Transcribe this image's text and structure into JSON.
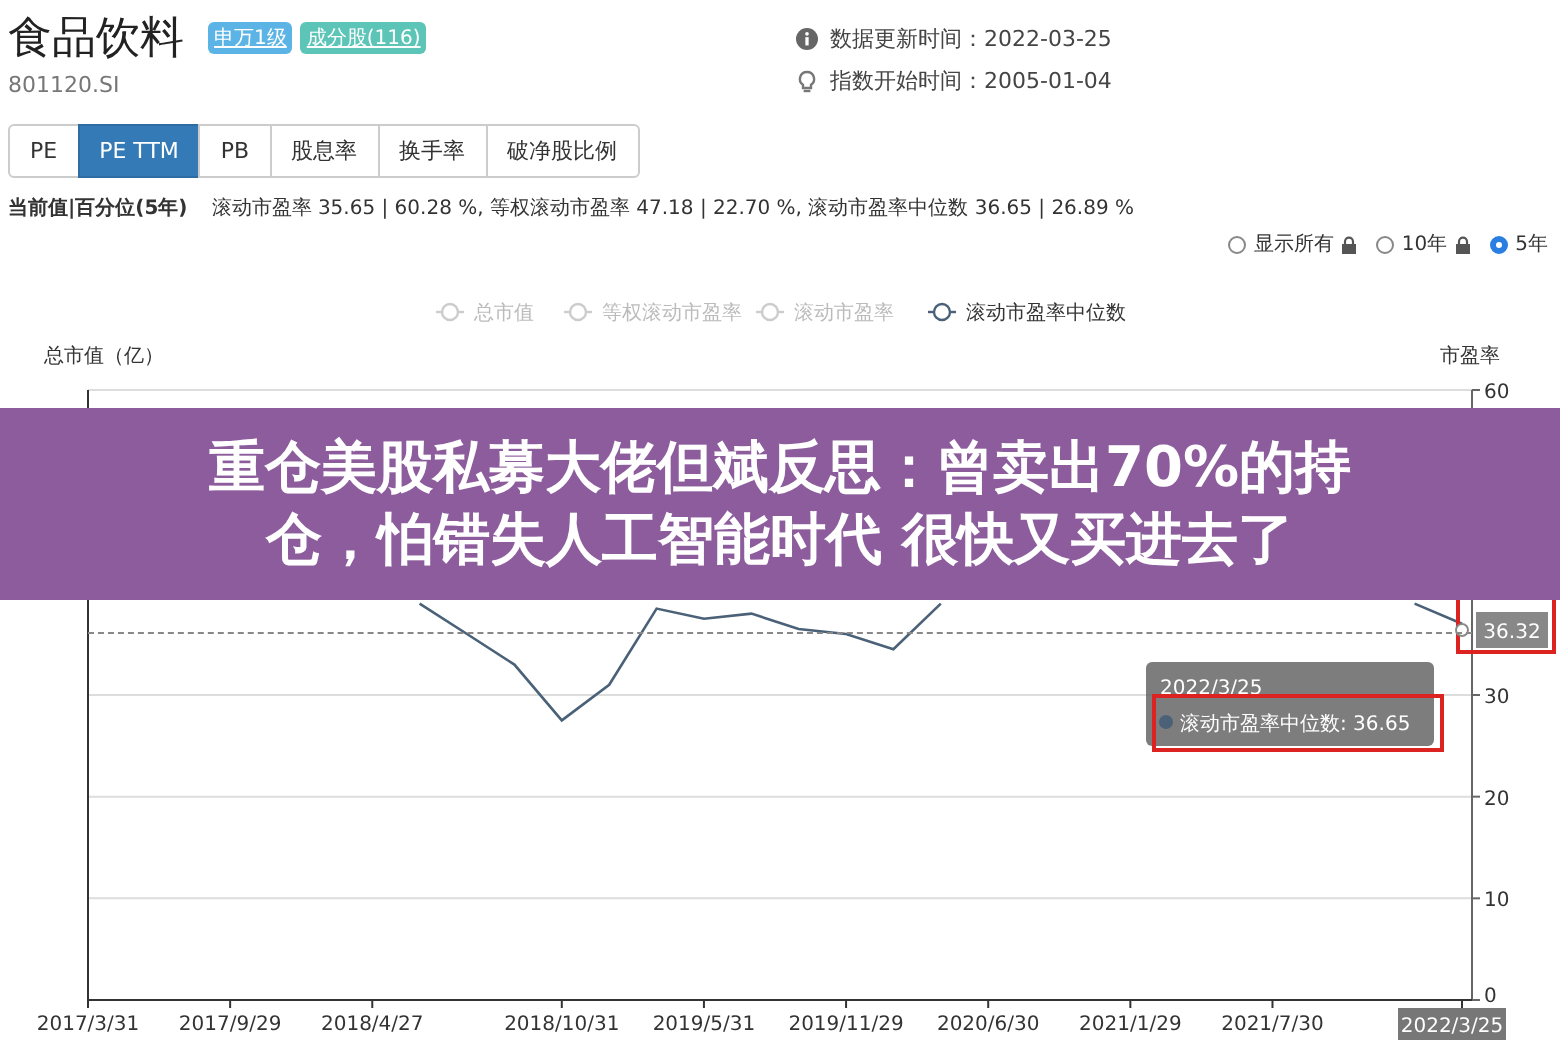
{
  "header": {
    "title": "食品饮料",
    "badges": [
      {
        "label": "申万1级",
        "color": "#5bb4e5"
      },
      {
        "label": "成分股(116)",
        "color": "#5cc5b7"
      }
    ],
    "code": "801120.SI",
    "info": [
      {
        "kind": "info",
        "text": "数据更新时间：2022-03-25"
      },
      {
        "kind": "bulb",
        "text": "指数开始时间：2005-01-04"
      }
    ]
  },
  "tabs": [
    {
      "label": "PE",
      "selected": false
    },
    {
      "label": "PE TTM",
      "selected": true
    },
    {
      "label": "PB",
      "selected": false
    },
    {
      "label": "股息率",
      "selected": false
    },
    {
      "label": "换手率",
      "selected": false
    },
    {
      "label": "破净股比例",
      "selected": false
    }
  ],
  "summary": {
    "label": "当前值|百分位(5年)",
    "text": "滚动市盈率 35.65 | 60.28 %, 等权滚动市盈率 47.18 | 22.70 %, 滚动市盈率中位数 36.65 | 26.89 %"
  },
  "ranges": [
    {
      "label": "显示所有",
      "locked": true,
      "selected": false
    },
    {
      "label": "10年",
      "locked": true,
      "selected": false
    },
    {
      "label": "5年",
      "locked": false,
      "selected": true
    }
  ],
  "legend": [
    {
      "label": "总市值",
      "selected": false
    },
    {
      "label": "等权滚动市盈率",
      "selected": false
    },
    {
      "label": "滚动市盈率",
      "selected": false
    }
  ],
  "chart": {
    "chart_data": {
      "type": "line",
      "ylabel": "市盈率",
      "y2label": "总市值（亿）",
      "categories": [
        "2017/3/31",
        null,
        null,
        "2017/9/29",
        null,
        null,
        "2018/4/27",
        null,
        null,
        null,
        "2018/10/31",
        null,
        null,
        "2019/5/31",
        null,
        null,
        "2019/11/29",
        null,
        null,
        "2020/6/30",
        null,
        null,
        "2021/1/29",
        null,
        null,
        "2021/7/30",
        null,
        null,
        null,
        "2022/3/25"
      ],
      "series": [
        {
          "name": "滚动市盈率中位数",
          "color": "#4a6178",
          "values": [
            null,
            null,
            null,
            null,
            null,
            null,
            null,
            39,
            36,
            33,
            27.5,
            31,
            38.5,
            37.5,
            38,
            36.5,
            36,
            34.5,
            39,
            null,
            null,
            null,
            null,
            null,
            null,
            null,
            null,
            null,
            39,
            37
          ]
        }
      ],
      "ylim": [
        0,
        60
      ],
      "yticks": [
        0,
        10,
        20,
        30,
        60
      ],
      "grid": true,
      "annotations": [
        "2022/3/25",
        "滚动市盈率中位数: 36.65",
        "36.32"
      ]
    }
  },
  "banner": {
    "lines": [
      "重仓美股私募大佬但斌反思：曾卖出70%的持",
      "仓，怕错失人工智能时代 很快又买进去了"
    ]
  }
}
